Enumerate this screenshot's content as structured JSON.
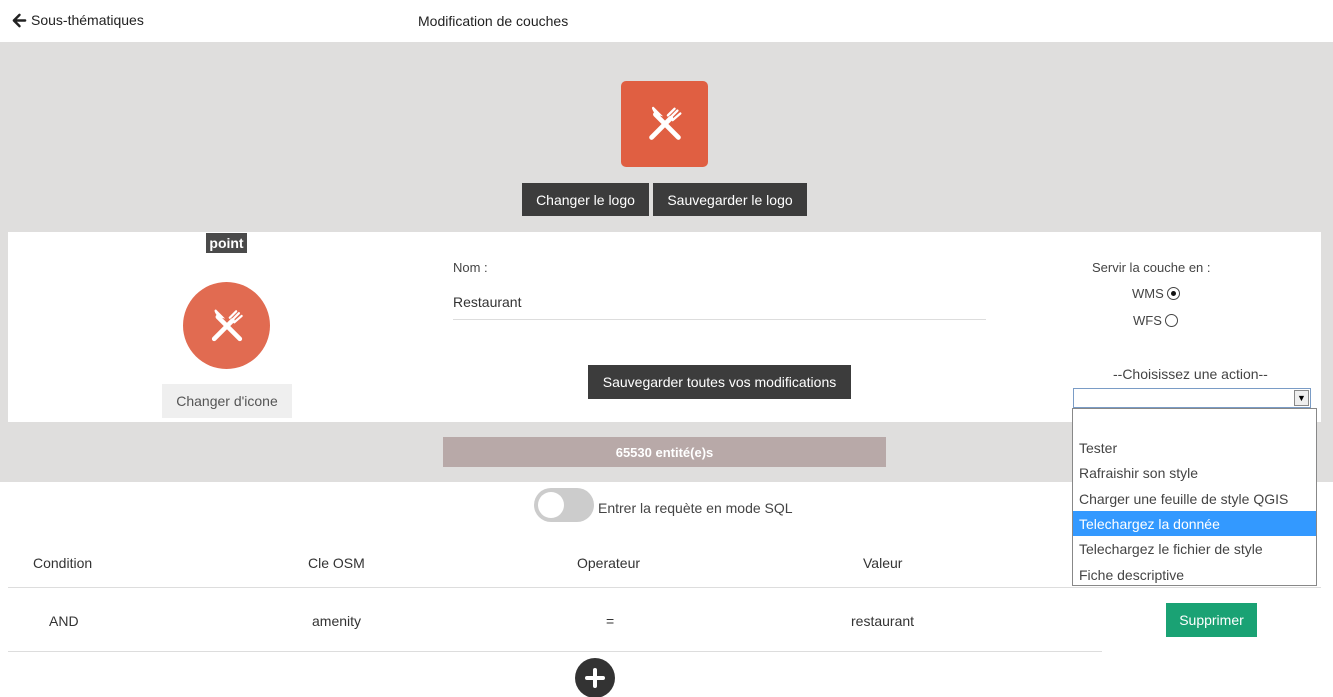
{
  "header": {
    "back_label": "Sous-thématiques",
    "title": "Modification de couches"
  },
  "logo": {
    "change_label": "Changer le logo",
    "save_label": "Sauvegarder le logo",
    "color": "#e05f42",
    "icon": "fork-knife-icon"
  },
  "layer": {
    "geometry_type": "point",
    "icon_color": "#e16b51",
    "change_icon_label": "Changer d'icone",
    "name_label": "Nom :",
    "name_value": "Restaurant",
    "save_all_label": "Sauvegarder toutes vos modifications"
  },
  "serve": {
    "label": "Servir la couche en :",
    "options": [
      {
        "label": "WMS",
        "selected": true
      },
      {
        "label": "WFS",
        "selected": false
      }
    ]
  },
  "actions": {
    "label": "--Choisissez une action--",
    "selected_value": "",
    "options": [
      "",
      "Tester",
      "Rafraishir son style",
      "Charger une feuille de style QGIS",
      "Telechargez la donnée",
      "Telechargez le fichier de style",
      "Fiche descriptive"
    ],
    "highlighted_index": 4
  },
  "count": {
    "label": "65530 entité(e)s"
  },
  "sql_toggle": {
    "label": "Entrer la requète en mode SQL",
    "on": false
  },
  "table": {
    "headers": [
      "Condition",
      "Cle OSM",
      "Operateur",
      "Valeur"
    ],
    "rows": [
      {
        "condition": "AND",
        "key": "amenity",
        "operator": "=",
        "value": "restaurant",
        "delete_label": "Supprimer"
      }
    ]
  },
  "colors": {
    "band": "#dfdedd",
    "dark_button": "#3c3c3c",
    "count_bar": "#b8a9a8",
    "delete_button": "#1aa274",
    "highlight": "#3399ff"
  }
}
